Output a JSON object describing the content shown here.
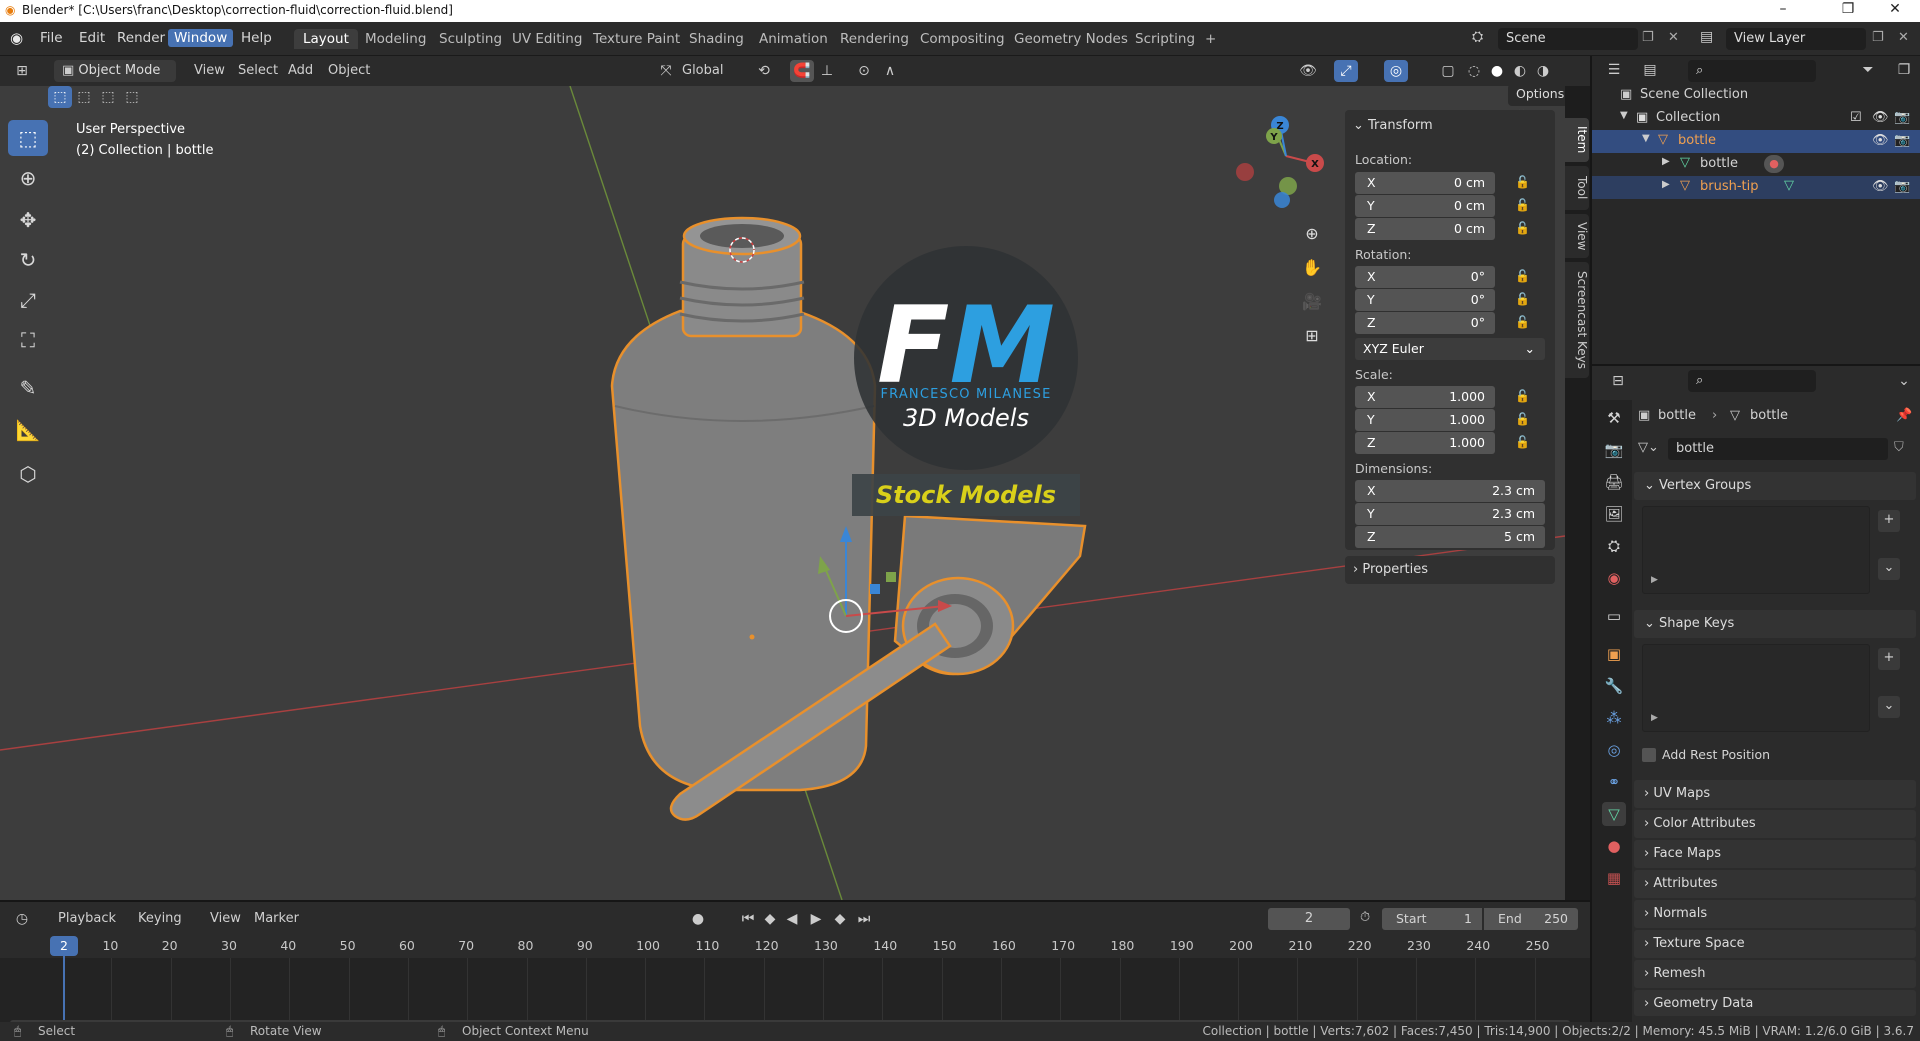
{
  "window": {
    "title": "Blender* [C:\\Users\\franc\\Desktop\\correction-fluid\\correction-fluid.blend]",
    "minimize": "–",
    "maximize": "❐",
    "close": "✕"
  },
  "menu": [
    "File",
    "Edit",
    "Render",
    "Window",
    "Help"
  ],
  "workspaces": [
    "Layout",
    "Modeling",
    "Sculpting",
    "UV Editing",
    "Texture Paint",
    "Shading",
    "Animation",
    "Rendering",
    "Compositing",
    "Geometry Nodes",
    "Scripting"
  ],
  "add_workspace": "+",
  "scene": {
    "name": "Scene",
    "view_layer": "View Layer"
  },
  "header": {
    "mode": "Object Mode",
    "view": "View",
    "select": "Select",
    "add": "Add",
    "object": "Object",
    "transform_orientation": "Global",
    "options": "Options"
  },
  "viewport": {
    "perspective": "User Perspective",
    "collection_info": "(2) Collection | bottle",
    "watermark_letters": "FM",
    "watermark_name": "FRANCESCO MILANESE",
    "watermark_sub": "3D Models",
    "watermark_banner": "Stock Models",
    "gizmo_axes": {
      "x": "X",
      "y": "Y",
      "z": "Z"
    }
  },
  "npanel": {
    "section": "Transform",
    "location_label": "Location:",
    "location": [
      {
        "axis": "X",
        "value": "0 cm"
      },
      {
        "axis": "Y",
        "value": "0 cm"
      },
      {
        "axis": "Z",
        "value": "0 cm"
      }
    ],
    "rotation_label": "Rotation:",
    "rotation": [
      {
        "axis": "X",
        "value": "0°"
      },
      {
        "axis": "Y",
        "value": "0°"
      },
      {
        "axis": "Z",
        "value": "0°"
      }
    ],
    "rotation_mode": "XYZ Euler",
    "scale_label": "Scale:",
    "scale": [
      {
        "axis": "X",
        "value": "1.000"
      },
      {
        "axis": "Y",
        "value": "1.000"
      },
      {
        "axis": "Z",
        "value": "1.000"
      }
    ],
    "dimensions_label": "Dimensions:",
    "dimensions": [
      {
        "axis": "X",
        "value": "2.3 cm"
      },
      {
        "axis": "Y",
        "value": "2.3 cm"
      },
      {
        "axis": "Z",
        "value": "5 cm"
      }
    ],
    "properties_section": "Properties",
    "tabs": [
      "Item",
      "Tool",
      "View",
      "Screencast Keys"
    ]
  },
  "outliner": {
    "root": "Scene Collection",
    "collection": "Collection",
    "items": [
      {
        "name": "bottle",
        "type": "object"
      },
      {
        "name": "bottle",
        "type": "mesh"
      },
      {
        "name": "brush-tip",
        "type": "object"
      }
    ]
  },
  "properties": {
    "breadcrumb_object": "bottle",
    "breadcrumb_data": "bottle",
    "data_name": "bottle",
    "sections": {
      "vertex_groups": "Vertex Groups",
      "shape_keys": "Shape Keys",
      "add_rest_position": "Add Rest Position",
      "collapsed": [
        "UV Maps",
        "Color Attributes",
        "Face Maps",
        "Attributes",
        "Normals",
        "Texture Space",
        "Remesh",
        "Geometry Data"
      ]
    }
  },
  "timeline": {
    "menus": [
      "Playback",
      "Keying",
      "View",
      "Marker"
    ],
    "current_frame": "2",
    "start_label": "Start",
    "start": "1",
    "end_label": "End",
    "end": "250",
    "ticks": [
      "10",
      "20",
      "30",
      "40",
      "50",
      "60",
      "70",
      "80",
      "90",
      "100",
      "110",
      "120",
      "130",
      "140",
      "150",
      "160",
      "170",
      "180",
      "190",
      "200",
      "210",
      "220",
      "230",
      "240",
      "250"
    ]
  },
  "status": {
    "select": "Select",
    "rotate": "Rotate View",
    "context": "Object Context Menu",
    "info": "Collection | bottle | Verts:7,602 | Faces:7,450 | Tris:14,900 | Objects:2/2 | Memory: 45.5 MiB | VRAM: 1.2/6.0 GiB | 3.6.7"
  },
  "colors": {
    "accent": "#4772b3",
    "selection_outline": "#e8902c",
    "x_axis": "#c94a4a",
    "y_axis": "#7ea34a",
    "z_axis": "#3a86d6",
    "mesh_data": "#63d7a6",
    "object_orange": "#f0a050"
  }
}
